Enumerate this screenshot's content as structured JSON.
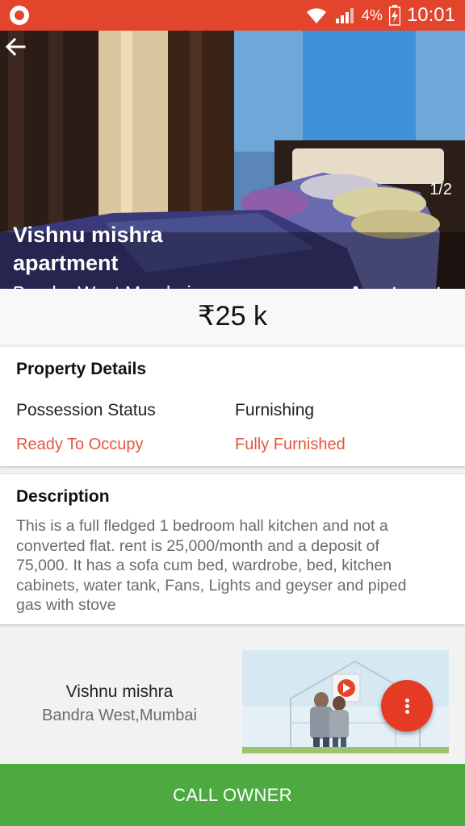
{
  "status_bar": {
    "battery": "4%",
    "time": "10:01"
  },
  "hero": {
    "counter": "1/2",
    "title": "Vishnu mishra apartment",
    "location": "Bandra West,Mumbai",
    "category": "Apartments"
  },
  "price": "₹25 k",
  "property_details": {
    "title": "Property Details",
    "possession_label": "Possession Status",
    "possession_value": "Ready To Occupy",
    "furnishing_label": "Furnishing",
    "furnishing_value": "Fully Furnished"
  },
  "description": {
    "title": "Description",
    "text": "This is a full fledged 1 bedroom hall kitchen and not a converted flat. rent is 25,000/month and a deposit of 75,000. It has a sofa cum bed, wardrobe, bed, kitchen cabinets, water tank, Fans, Lights and geyser and piped gas with stove"
  },
  "owner": {
    "name": "Vishnu mishra",
    "location": "Bandra West,Mumbai"
  },
  "call_button": "CALL OWNER",
  "colors": {
    "accent": "#e2452b",
    "call": "#4daa41",
    "value": "#e2583e"
  }
}
